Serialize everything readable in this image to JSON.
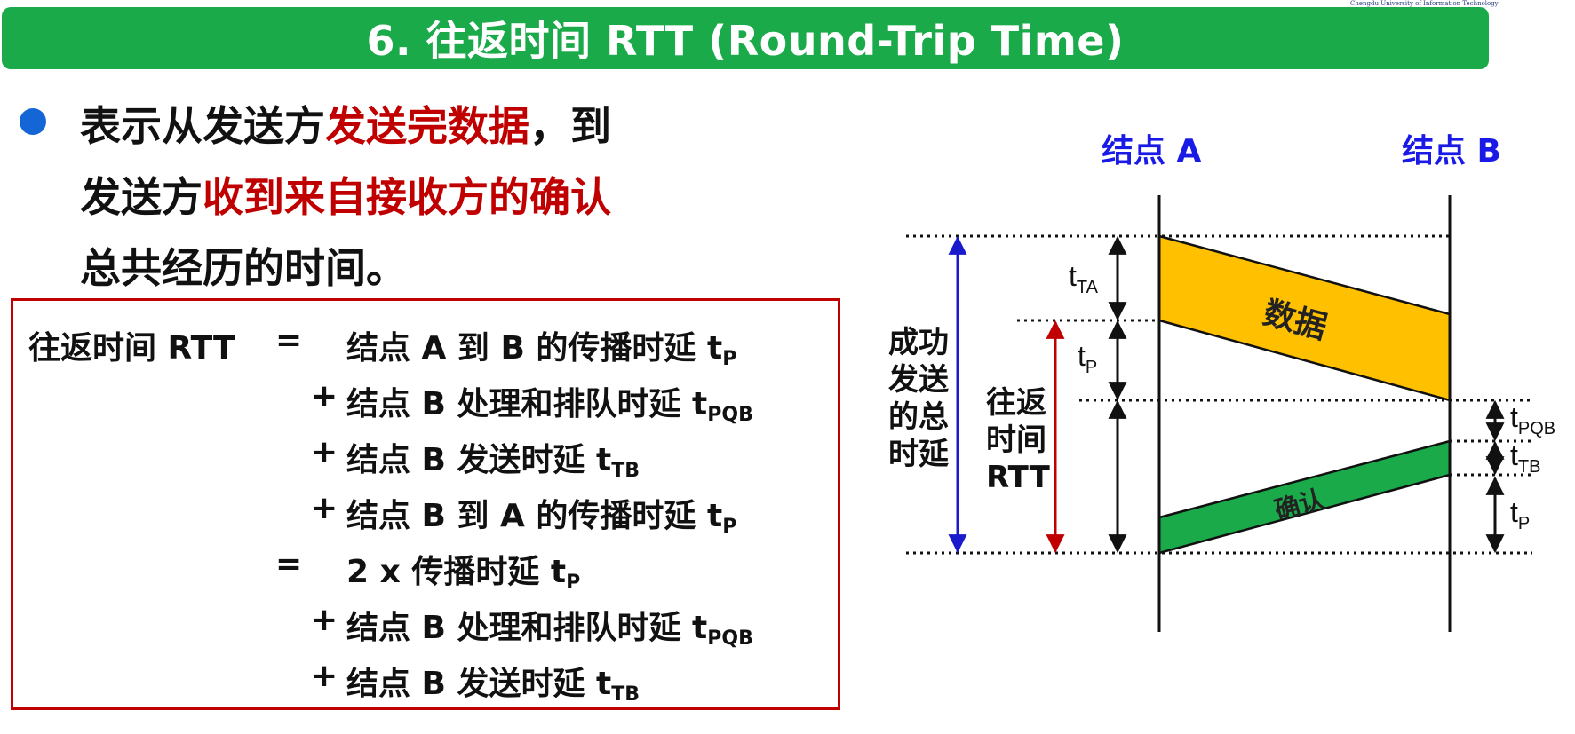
{
  "header": {
    "logo_caption": "Chengdu University of Information Technology",
    "title": "6. 往返时间 RTT (Round-Trip Time)"
  },
  "bullet": {
    "line1_a": "表示从发送方",
    "line1_b": "发送完数据",
    "line1_c": "，到",
    "line2_a": "发送方",
    "line2_b": "收到来自接收方的确认",
    "line3": "总共经历的时间。"
  },
  "formula": {
    "rtt_label": "往返时间 RTT",
    "equals": "=",
    "plus": "+",
    "t": "t",
    "rows": [
      {
        "text": "结点 A 到 B 的传播时延 ",
        "sub": "P"
      },
      {
        "text": "结点 B 处理和排队时延 ",
        "sub": "PQB"
      },
      {
        "text": "结点 B 发送时延 ",
        "sub": "TB"
      },
      {
        "text": "结点 B 到 A 的传播时延 ",
        "sub": "P"
      },
      {
        "text": "2 x 传播时延 ",
        "sub": "P"
      },
      {
        "text": "结点 B 处理和排队时延 ",
        "sub": "PQB"
      },
      {
        "text": "结点 B 发送时延 ",
        "sub": "TB"
      }
    ]
  },
  "diagram": {
    "node_a": "结点 A",
    "node_b": "结点 B",
    "data_label": "数据",
    "ack_label": "确认",
    "total_label": [
      "成功",
      "发送",
      "的总",
      "时延"
    ],
    "rtt_label": [
      "往返",
      "时间",
      "RTT"
    ],
    "t": "t",
    "sub_ta": "TA",
    "sub_p": "P",
    "sub_pqb": "PQB",
    "sub_tb": "TB",
    "colors": {
      "header_green": "#1aaa4a",
      "node_label_blue": "#1a1ae6",
      "data_fill": "#ffc000",
      "ack_fill": "#1aaa4a",
      "total_arrow_blue": "#1a1acc",
      "rtt_arrow_red": "#c00000",
      "highlight_red": "#c00000",
      "bullet_blue": "#1466d6"
    }
  }
}
